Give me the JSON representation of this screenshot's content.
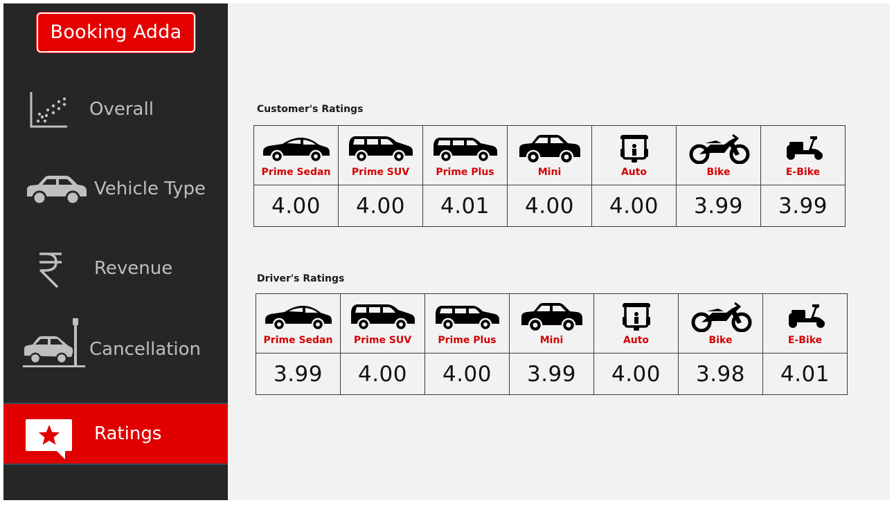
{
  "brand": {
    "title": "Booking Adda"
  },
  "sidebar": {
    "items": [
      {
        "label": "Overall",
        "icon": "scatter-chart-icon",
        "active": false
      },
      {
        "label": "Vehicle Type",
        "icon": "car-icon",
        "active": false
      },
      {
        "label": "Revenue",
        "icon": "rupee-icon",
        "active": false
      },
      {
        "label": "Cancellation",
        "icon": "car-crash-icon",
        "active": false
      },
      {
        "label": "Ratings",
        "icon": "star-message-icon",
        "active": true
      }
    ]
  },
  "customer_ratings": {
    "title": "Customer's Ratings",
    "vehicles": [
      {
        "label": "Prime Sedan",
        "icon": "sedan-icon",
        "value": "4.00"
      },
      {
        "label": "Prime SUV",
        "icon": "suv-icon",
        "value": "4.00"
      },
      {
        "label": "Prime Plus",
        "icon": "hatchback-icon",
        "value": "4.01"
      },
      {
        "label": "Mini",
        "icon": "mini-car-icon",
        "value": "4.00"
      },
      {
        "label": "Auto",
        "icon": "auto-rickshaw-icon",
        "value": "4.00"
      },
      {
        "label": "Bike",
        "icon": "motorbike-icon",
        "value": "3.99"
      },
      {
        "label": "E-Bike",
        "icon": "scooter-icon",
        "value": "3.99"
      }
    ]
  },
  "driver_ratings": {
    "title": "Driver's Ratings",
    "vehicles": [
      {
        "label": "Prime Sedan",
        "icon": "sedan-icon",
        "value": "3.99"
      },
      {
        "label": "Prime SUV",
        "icon": "suv-icon",
        "value": "4.00"
      },
      {
        "label": "Prime Plus",
        "icon": "hatchback-icon",
        "value": "4.00"
      },
      {
        "label": "Mini",
        "icon": "mini-car-icon",
        "value": "3.99"
      },
      {
        "label": "Auto",
        "icon": "auto-rickshaw-icon",
        "value": "4.00"
      },
      {
        "label": "Bike",
        "icon": "motorbike-icon",
        "value": "3.98"
      },
      {
        "label": "E-Bike",
        "icon": "scooter-icon",
        "value": "4.01"
      }
    ]
  },
  "colors": {
    "accent": "#e00000",
    "sidebar": "#262626",
    "background": "#f2f2f2",
    "label_red": "#d40000"
  }
}
